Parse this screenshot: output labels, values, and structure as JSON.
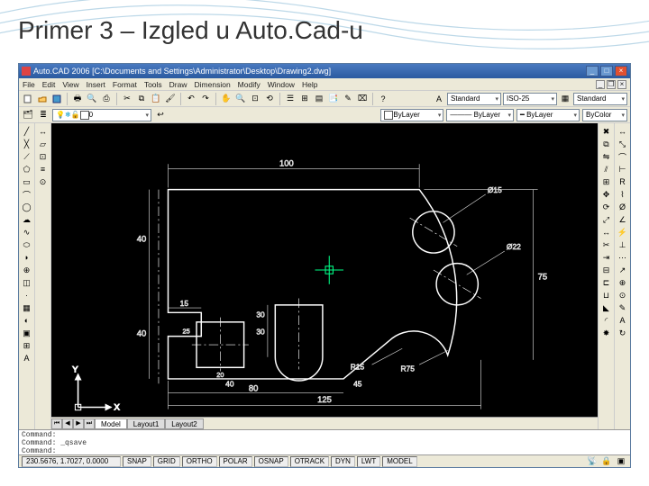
{
  "slide": {
    "title": "Primer 3 – Izgled u Auto.Cad-u"
  },
  "titlebar": {
    "app": "Auto.CAD 2006",
    "path": "[C:\\Documents and Settings\\Administrator\\Desktop\\Drawing2.dwg]"
  },
  "menus": [
    "File",
    "Edit",
    "View",
    "Insert",
    "Format",
    "Tools",
    "Draw",
    "Dimension",
    "Modify",
    "Window",
    "Help"
  ],
  "toolbar1": {
    "style_dd": "Standard",
    "dim_dd": "ISO-25",
    "table_dd": "Standard"
  },
  "layer_row": {
    "current": "0",
    "bylayer1": "ByLayer",
    "color": "#ffffff",
    "linetype": "ByLayer",
    "lineweight": "ByLayer",
    "bycolor": "ByColor"
  },
  "tabs": {
    "model": "Model",
    "l1": "Layout1",
    "l2": "Layout2"
  },
  "commandline": {
    "line1": "Command:",
    "line2": "Command: _qsave",
    "prompt": "Command:"
  },
  "status": {
    "coords": "230.5676, 1.7027, 0.0000",
    "snap": "SNAP",
    "grid": "GRID",
    "ortho": "ORTHO",
    "polar": "POLAR",
    "osnap": "OSNAP",
    "otrack": "OTRACK",
    "dyn": "DYN",
    "lwt": "LWT",
    "model": "MODEL"
  },
  "drawing": {
    "dims": {
      "overall_w": "125",
      "top": "100",
      "left_upper_h": "40",
      "left_lower_h": "40",
      "notch_w": "15",
      "notch_h": "30",
      "rect_w": "20",
      "rect_h": "25",
      "slot_h": "30",
      "right_h": "75",
      "bottom2": "40",
      "bottom3": "45",
      "diag1": "Ø15",
      "diag2": "Ø22",
      "r_small": "R15",
      "r_large": "R75",
      "overall_h": "80"
    },
    "cursor": "+",
    "ucs": {
      "x": "X",
      "y": "Y"
    }
  },
  "colors": {
    "draw": "#ffffff",
    "dim": "#e0e0e0",
    "cursor": "#00ff88",
    "bg": "#000000"
  }
}
